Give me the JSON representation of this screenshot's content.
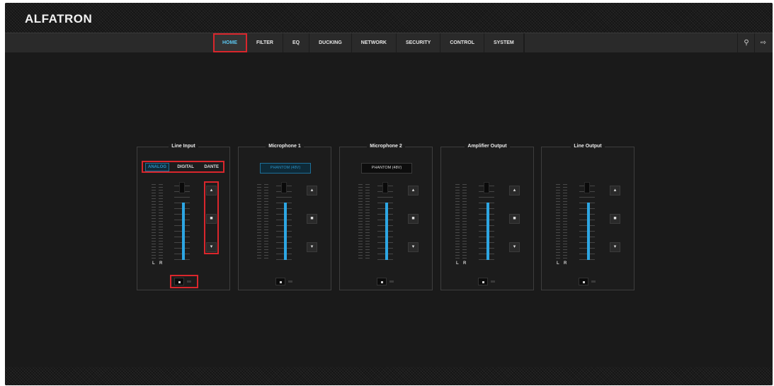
{
  "app": {
    "title": "ALFATRON"
  },
  "nav": {
    "tabs": [
      {
        "label": "HOME",
        "active": true
      },
      {
        "label": "FILTER"
      },
      {
        "label": "EQ"
      },
      {
        "label": "DUCKING"
      },
      {
        "label": "NETWORK"
      },
      {
        "label": "SECURITY"
      },
      {
        "label": "CONTROL"
      },
      {
        "label": "SYSTEM"
      }
    ],
    "icons": [
      "lightbulb-icon",
      "logout-icon"
    ]
  },
  "panels": [
    {
      "title": "Line Input",
      "source_options": [
        "ANALOG",
        "DIGITAL",
        "DANTE"
      ],
      "selected_source": "ANALOG",
      "channel_labels": [
        "L",
        "R"
      ]
    },
    {
      "title": "Microphone 1",
      "phantom_label": "PHANTOM (48V)",
      "phantom_on": true
    },
    {
      "title": "Microphone 2",
      "phantom_label": "PHANTOM (48V)",
      "phantom_on": false
    },
    {
      "title": "Amplifier Output",
      "channel_labels": [
        "L",
        "R"
      ]
    },
    {
      "title": "Line Output",
      "channel_labels": [
        "L",
        "R"
      ]
    }
  ],
  "channel_buttons": [
    "volume-up-icon",
    "mute-icon",
    "volume-down-icon"
  ],
  "colors": {
    "accent": "#2da6e3",
    "highlight": "#d9262c",
    "background": "#1a1a1a"
  }
}
